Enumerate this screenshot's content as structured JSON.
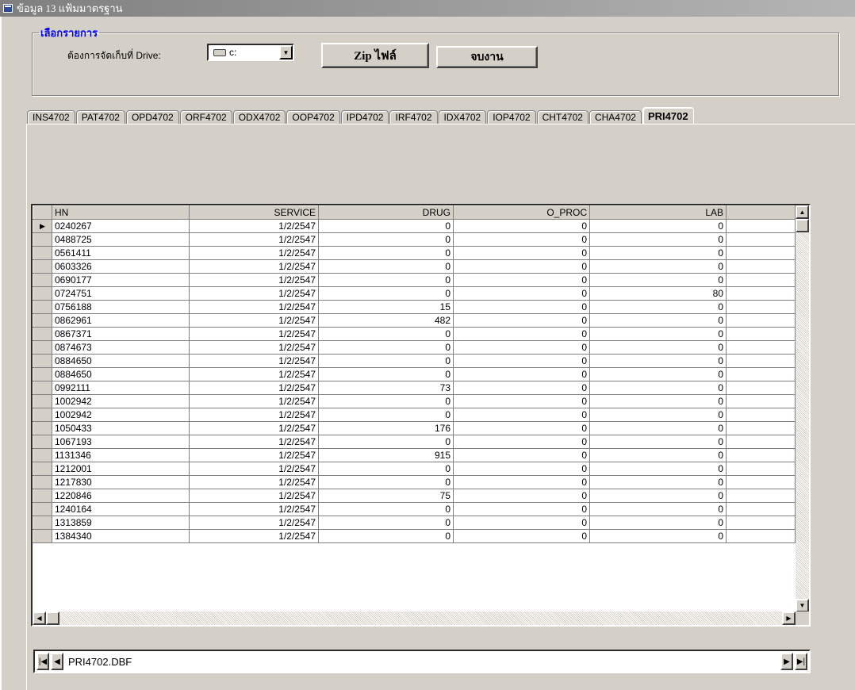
{
  "window": {
    "title": "ข้อมูล 13 แฟ้มมาตรฐาน"
  },
  "group": {
    "legend": "เลือกรายการ",
    "drive_label": "ต้องการจัดเก็บที่ Drive:",
    "drive_value": "c:",
    "zip_button": "Zip ไฟล์",
    "exit_button": "จบงาน"
  },
  "tabs": [
    {
      "label": "INS4702"
    },
    {
      "label": "PAT4702"
    },
    {
      "label": "OPD4702"
    },
    {
      "label": "ORF4702"
    },
    {
      "label": "ODX4702"
    },
    {
      "label": "OOP4702"
    },
    {
      "label": "IPD4702"
    },
    {
      "label": "IRF4702"
    },
    {
      "label": "IDX4702"
    },
    {
      "label": "IOP4702"
    },
    {
      "label": "CHT4702"
    },
    {
      "label": "CHA4702"
    },
    {
      "label": "PRI4702"
    }
  ],
  "active_tab": "PRI4702",
  "grid": {
    "columns": [
      "HN",
      "SERVICE",
      "DRUG",
      "O_PROC",
      "LAB"
    ],
    "rows": [
      [
        "0240267",
        "1/2/2547",
        "0",
        "0",
        "0"
      ],
      [
        "0488725",
        "1/2/2547",
        "0",
        "0",
        "0"
      ],
      [
        "0561411",
        "1/2/2547",
        "0",
        "0",
        "0"
      ],
      [
        "0603326",
        "1/2/2547",
        "0",
        "0",
        "0"
      ],
      [
        "0690177",
        "1/2/2547",
        "0",
        "0",
        "0"
      ],
      [
        "0724751",
        "1/2/2547",
        "0",
        "0",
        "80"
      ],
      [
        "0756188",
        "1/2/2547",
        "15",
        "0",
        "0"
      ],
      [
        "0862961",
        "1/2/2547",
        "482",
        "0",
        "0"
      ],
      [
        "0867371",
        "1/2/2547",
        "0",
        "0",
        "0"
      ],
      [
        "0874673",
        "1/2/2547",
        "0",
        "0",
        "0"
      ],
      [
        "0884650",
        "1/2/2547",
        "0",
        "0",
        "0"
      ],
      [
        "0884650",
        "1/2/2547",
        "0",
        "0",
        "0"
      ],
      [
        "0992111",
        "1/2/2547",
        "73",
        "0",
        "0"
      ],
      [
        "1002942",
        "1/2/2547",
        "0",
        "0",
        "0"
      ],
      [
        "1002942",
        "1/2/2547",
        "0",
        "0",
        "0"
      ],
      [
        "1050433",
        "1/2/2547",
        "176",
        "0",
        "0"
      ],
      [
        "1067193",
        "1/2/2547",
        "0",
        "0",
        "0"
      ],
      [
        "1131346",
        "1/2/2547",
        "915",
        "0",
        "0"
      ],
      [
        "1212001",
        "1/2/2547",
        "0",
        "0",
        "0"
      ],
      [
        "1217830",
        "1/2/2547",
        "0",
        "0",
        "0"
      ],
      [
        "1220846",
        "1/2/2547",
        "75",
        "0",
        "0"
      ],
      [
        "1240164",
        "1/2/2547",
        "0",
        "0",
        "0"
      ],
      [
        "1313859",
        "1/2/2547",
        "0",
        "0",
        "0"
      ],
      [
        "1384340",
        "1/2/2547",
        "0",
        "0",
        "0"
      ]
    ]
  },
  "navigator": {
    "label": "PRI4702.DBF"
  }
}
